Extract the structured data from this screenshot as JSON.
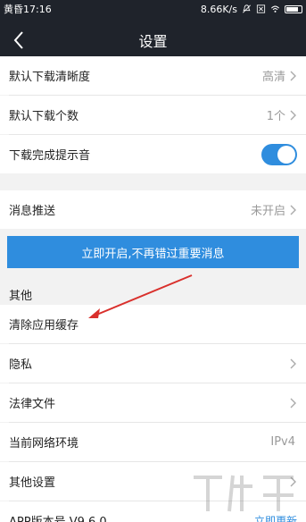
{
  "status_bar": {
    "time": "黄昏17:16",
    "speed": "8.66K/s"
  },
  "nav": {
    "title": "设置"
  },
  "settings": {
    "download_quality": {
      "label": "默认下载清晰度",
      "value": "高清"
    },
    "download_count": {
      "label": "默认下载个数",
      "value": "1个"
    },
    "download_sound": {
      "label": "下载完成提示音",
      "enabled": true
    },
    "push": {
      "label": "消息推送",
      "value": "未开启"
    },
    "open_push_button": "立即开启,不再错过重要消息",
    "section_other": "其他",
    "clear_cache": {
      "label": "清除应用缓存"
    },
    "privacy": {
      "label": "隐私"
    },
    "legal": {
      "label": "法律文件"
    },
    "network": {
      "label": "当前网络环境",
      "value": "IPv4"
    },
    "other_settings": {
      "label": "其他设置"
    },
    "app_version": {
      "label": "APP版本号 V9.6.0",
      "update_label": "立即更新"
    }
  },
  "colors": {
    "accent": "#2f8dde",
    "header": "#1f232b",
    "annotation_arrow": "#d9302c"
  }
}
